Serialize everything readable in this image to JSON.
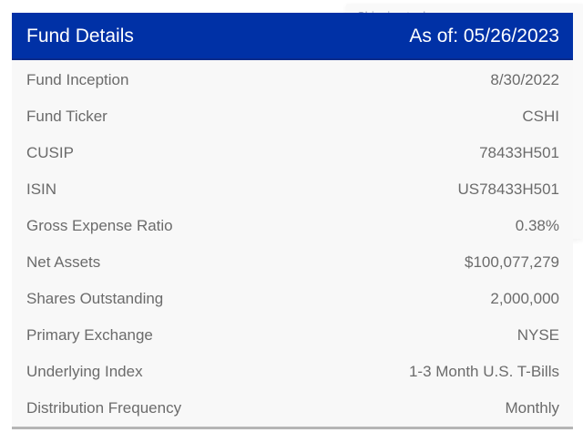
{
  "background_link": {
    "label": "Shipping tool"
  },
  "fund_details": {
    "title": "Fund Details",
    "as_of": "As of: 05/26/2023",
    "rows": [
      {
        "label": "Fund Inception",
        "value": "8/30/2022"
      },
      {
        "label": "Fund Ticker",
        "value": "CSHI"
      },
      {
        "label": "CUSIP",
        "value": "78433H501"
      },
      {
        "label": "ISIN",
        "value": "US78433H501"
      },
      {
        "label": "Gross Expense Ratio",
        "value": "0.38%"
      },
      {
        "label": "Net Assets",
        "value": "$100,077,279"
      },
      {
        "label": "Shares Outstanding",
        "value": "2,000,000"
      },
      {
        "label": "Primary Exchange",
        "value": "NYSE"
      },
      {
        "label": "Underlying Index",
        "value": "1-3 Month U.S. T-Bills"
      },
      {
        "label": "Distribution Frequency",
        "value": "Monthly"
      }
    ]
  },
  "colors": {
    "header_background": "#0031a6",
    "header_text": "#ffffff",
    "row_text": "#6b6b6b",
    "bottom_rule": "#b5b5b5"
  }
}
